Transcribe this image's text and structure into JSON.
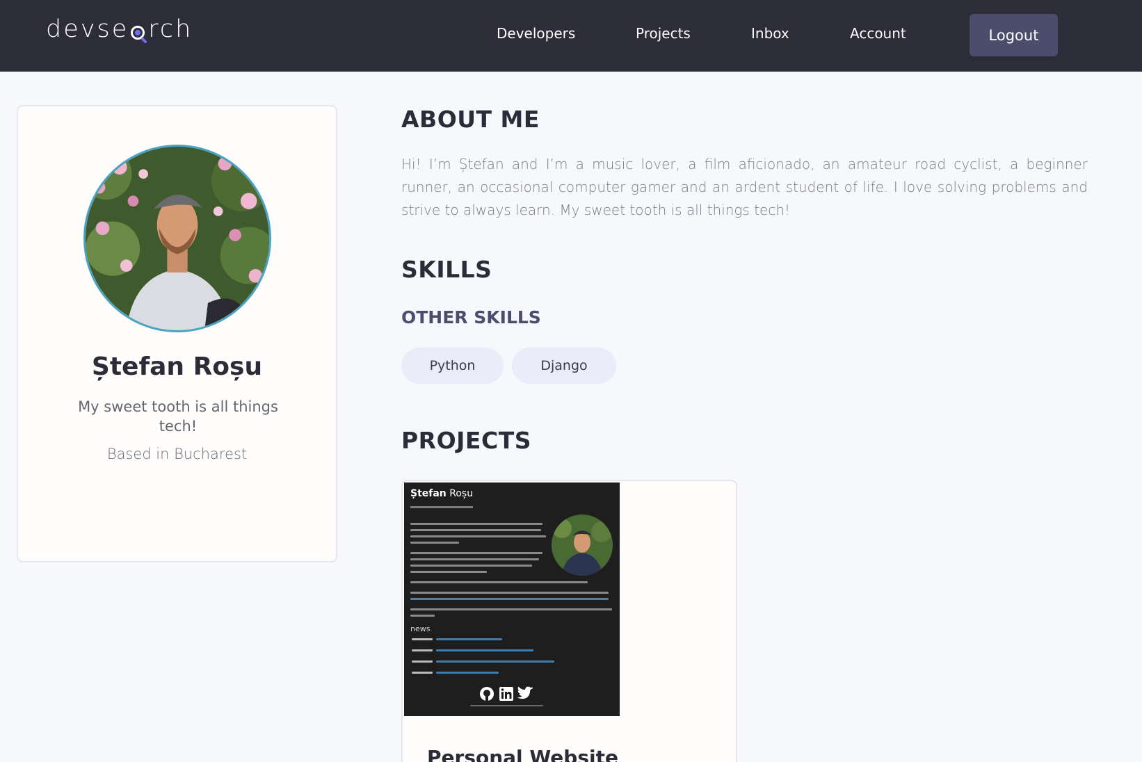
{
  "header": {
    "logo_left": "devse",
    "logo_right": "rch",
    "nav": [
      {
        "label": "Developers"
      },
      {
        "label": "Projects"
      },
      {
        "label": "Inbox"
      },
      {
        "label": "Account"
      }
    ],
    "logout_label": "Logout"
  },
  "profile": {
    "name": "Ștefan Roșu",
    "tagline": "My sweet tooth is all things tech!",
    "location": "Based in Bucharest"
  },
  "about": {
    "heading": "ABOUT ME",
    "text": "Hi! I’m Ștefan and I’m a music lover, a film aficionado, an amateur road cyclist, a beginner runner, an occasional computer gamer and an ardent student of life. I love solving problems and strive to always learn. My sweet tooth is all things tech!"
  },
  "skills": {
    "heading": "SKILLS",
    "other_heading": "OTHER SKILLS",
    "tags": [
      {
        "label": "Python"
      },
      {
        "label": "Django"
      }
    ]
  },
  "projects": {
    "heading": "PROJECTS",
    "items": [
      {
        "title": "Personal Website",
        "thumb_name_bold": "Ștefan",
        "thumb_name_rest": " Roșu",
        "thumb_news": "news"
      }
    ]
  },
  "colors": {
    "header_bg": "#2d2d39",
    "accent": "#4a4d6b",
    "page_bg": "#f7f8fc",
    "skill_tag_bg": "#ebebfa"
  }
}
